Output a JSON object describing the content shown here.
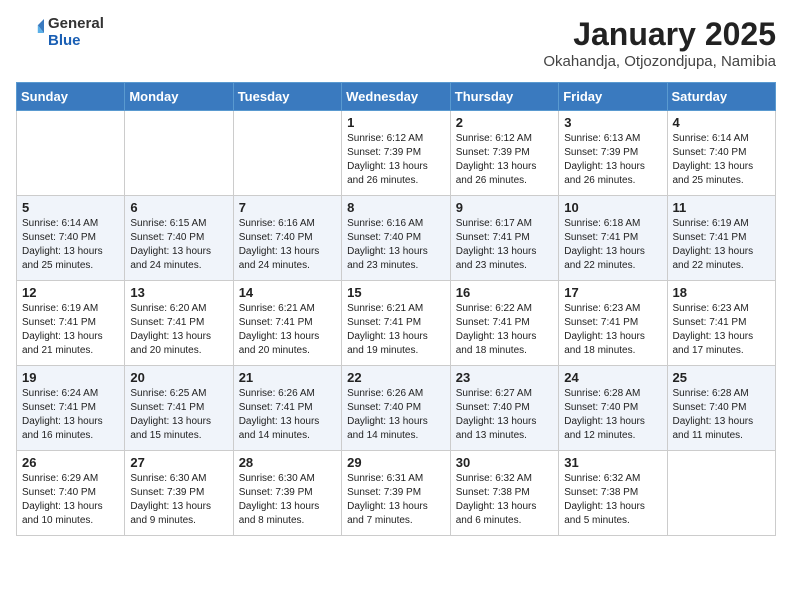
{
  "header": {
    "logo": {
      "general": "General",
      "blue": "Blue"
    },
    "title": "January 2025",
    "location": "Okahandja, Otjozondjupa, Namibia"
  },
  "weekdays": [
    "Sunday",
    "Monday",
    "Tuesday",
    "Wednesday",
    "Thursday",
    "Friday",
    "Saturday"
  ],
  "weeks": [
    [
      {
        "day": "",
        "sunrise": "",
        "sunset": "",
        "daylight": ""
      },
      {
        "day": "",
        "sunrise": "",
        "sunset": "",
        "daylight": ""
      },
      {
        "day": "",
        "sunrise": "",
        "sunset": "",
        "daylight": ""
      },
      {
        "day": "1",
        "sunrise": "Sunrise: 6:12 AM",
        "sunset": "Sunset: 7:39 PM",
        "daylight": "Daylight: 13 hours and 26 minutes."
      },
      {
        "day": "2",
        "sunrise": "Sunrise: 6:12 AM",
        "sunset": "Sunset: 7:39 PM",
        "daylight": "Daylight: 13 hours and 26 minutes."
      },
      {
        "day": "3",
        "sunrise": "Sunrise: 6:13 AM",
        "sunset": "Sunset: 7:39 PM",
        "daylight": "Daylight: 13 hours and 26 minutes."
      },
      {
        "day": "4",
        "sunrise": "Sunrise: 6:14 AM",
        "sunset": "Sunset: 7:40 PM",
        "daylight": "Daylight: 13 hours and 25 minutes."
      }
    ],
    [
      {
        "day": "5",
        "sunrise": "Sunrise: 6:14 AM",
        "sunset": "Sunset: 7:40 PM",
        "daylight": "Daylight: 13 hours and 25 minutes."
      },
      {
        "day": "6",
        "sunrise": "Sunrise: 6:15 AM",
        "sunset": "Sunset: 7:40 PM",
        "daylight": "Daylight: 13 hours and 24 minutes."
      },
      {
        "day": "7",
        "sunrise": "Sunrise: 6:16 AM",
        "sunset": "Sunset: 7:40 PM",
        "daylight": "Daylight: 13 hours and 24 minutes."
      },
      {
        "day": "8",
        "sunrise": "Sunrise: 6:16 AM",
        "sunset": "Sunset: 7:40 PM",
        "daylight": "Daylight: 13 hours and 23 minutes."
      },
      {
        "day": "9",
        "sunrise": "Sunrise: 6:17 AM",
        "sunset": "Sunset: 7:41 PM",
        "daylight": "Daylight: 13 hours and 23 minutes."
      },
      {
        "day": "10",
        "sunrise": "Sunrise: 6:18 AM",
        "sunset": "Sunset: 7:41 PM",
        "daylight": "Daylight: 13 hours and 22 minutes."
      },
      {
        "day": "11",
        "sunrise": "Sunrise: 6:19 AM",
        "sunset": "Sunset: 7:41 PM",
        "daylight": "Daylight: 13 hours and 22 minutes."
      }
    ],
    [
      {
        "day": "12",
        "sunrise": "Sunrise: 6:19 AM",
        "sunset": "Sunset: 7:41 PM",
        "daylight": "Daylight: 13 hours and 21 minutes."
      },
      {
        "day": "13",
        "sunrise": "Sunrise: 6:20 AM",
        "sunset": "Sunset: 7:41 PM",
        "daylight": "Daylight: 13 hours and 20 minutes."
      },
      {
        "day": "14",
        "sunrise": "Sunrise: 6:21 AM",
        "sunset": "Sunset: 7:41 PM",
        "daylight": "Daylight: 13 hours and 20 minutes."
      },
      {
        "day": "15",
        "sunrise": "Sunrise: 6:21 AM",
        "sunset": "Sunset: 7:41 PM",
        "daylight": "Daylight: 13 hours and 19 minutes."
      },
      {
        "day": "16",
        "sunrise": "Sunrise: 6:22 AM",
        "sunset": "Sunset: 7:41 PM",
        "daylight": "Daylight: 13 hours and 18 minutes."
      },
      {
        "day": "17",
        "sunrise": "Sunrise: 6:23 AM",
        "sunset": "Sunset: 7:41 PM",
        "daylight": "Daylight: 13 hours and 18 minutes."
      },
      {
        "day": "18",
        "sunrise": "Sunrise: 6:23 AM",
        "sunset": "Sunset: 7:41 PM",
        "daylight": "Daylight: 13 hours and 17 minutes."
      }
    ],
    [
      {
        "day": "19",
        "sunrise": "Sunrise: 6:24 AM",
        "sunset": "Sunset: 7:41 PM",
        "daylight": "Daylight: 13 hours and 16 minutes."
      },
      {
        "day": "20",
        "sunrise": "Sunrise: 6:25 AM",
        "sunset": "Sunset: 7:41 PM",
        "daylight": "Daylight: 13 hours and 15 minutes."
      },
      {
        "day": "21",
        "sunrise": "Sunrise: 6:26 AM",
        "sunset": "Sunset: 7:41 PM",
        "daylight": "Daylight: 13 hours and 14 minutes."
      },
      {
        "day": "22",
        "sunrise": "Sunrise: 6:26 AM",
        "sunset": "Sunset: 7:40 PM",
        "daylight": "Daylight: 13 hours and 14 minutes."
      },
      {
        "day": "23",
        "sunrise": "Sunrise: 6:27 AM",
        "sunset": "Sunset: 7:40 PM",
        "daylight": "Daylight: 13 hours and 13 minutes."
      },
      {
        "day": "24",
        "sunrise": "Sunrise: 6:28 AM",
        "sunset": "Sunset: 7:40 PM",
        "daylight": "Daylight: 13 hours and 12 minutes."
      },
      {
        "day": "25",
        "sunrise": "Sunrise: 6:28 AM",
        "sunset": "Sunset: 7:40 PM",
        "daylight": "Daylight: 13 hours and 11 minutes."
      }
    ],
    [
      {
        "day": "26",
        "sunrise": "Sunrise: 6:29 AM",
        "sunset": "Sunset: 7:40 PM",
        "daylight": "Daylight: 13 hours and 10 minutes."
      },
      {
        "day": "27",
        "sunrise": "Sunrise: 6:30 AM",
        "sunset": "Sunset: 7:39 PM",
        "daylight": "Daylight: 13 hours and 9 minutes."
      },
      {
        "day": "28",
        "sunrise": "Sunrise: 6:30 AM",
        "sunset": "Sunset: 7:39 PM",
        "daylight": "Daylight: 13 hours and 8 minutes."
      },
      {
        "day": "29",
        "sunrise": "Sunrise: 6:31 AM",
        "sunset": "Sunset: 7:39 PM",
        "daylight": "Daylight: 13 hours and 7 minutes."
      },
      {
        "day": "30",
        "sunrise": "Sunrise: 6:32 AM",
        "sunset": "Sunset: 7:38 PM",
        "daylight": "Daylight: 13 hours and 6 minutes."
      },
      {
        "day": "31",
        "sunrise": "Sunrise: 6:32 AM",
        "sunset": "Sunset: 7:38 PM",
        "daylight": "Daylight: 13 hours and 5 minutes."
      },
      {
        "day": "",
        "sunrise": "",
        "sunset": "",
        "daylight": ""
      }
    ]
  ]
}
